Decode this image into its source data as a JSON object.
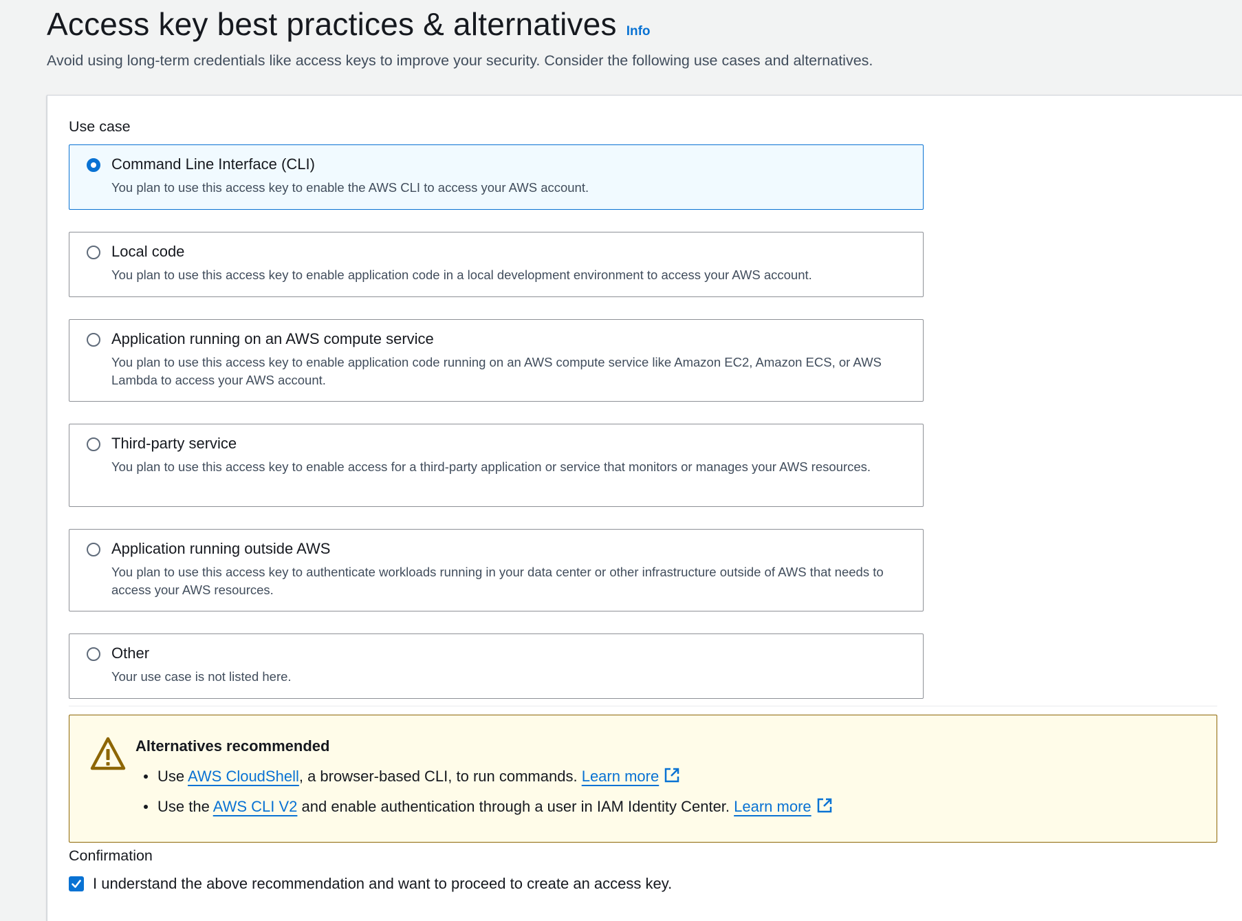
{
  "header": {
    "title": "Access key best practices & alternatives",
    "info_label": "Info",
    "description": "Avoid using long-term credentials like access keys to improve your security. Consider the following use cases and alternatives."
  },
  "use_case": {
    "label": "Use case",
    "selected": "cli",
    "options": [
      {
        "id": "cli",
        "title": "Command Line Interface (CLI)",
        "description": "You plan to use this access key to enable the AWS CLI to access your AWS account."
      },
      {
        "id": "local-code",
        "title": "Local code",
        "description": "You plan to use this access key to enable application code in a local development environment to access your AWS account."
      },
      {
        "id": "aws-compute",
        "title": "Application running on an AWS compute service",
        "description": "You plan to use this access key to enable application code running on an AWS compute service like Amazon EC2, Amazon ECS, or AWS Lambda to access your AWS account."
      },
      {
        "id": "third-party",
        "title": "Third-party service",
        "description": "You plan to use this access key to enable access for a third-party application or service that monitors or manages your AWS resources."
      },
      {
        "id": "outside-aws",
        "title": "Application running outside AWS",
        "description": "You plan to use this access key to authenticate workloads running in your data center or other infrastructure outside of AWS that needs to access your AWS resources."
      },
      {
        "id": "other",
        "title": "Other",
        "description": "Your use case is not listed here."
      }
    ]
  },
  "alert": {
    "title": "Alternatives recommended",
    "icon": "warning-icon",
    "items": [
      {
        "prefix": "Use ",
        "link_text": "AWS CloudShell",
        "suffix": ", a browser-based CLI, to run commands. ",
        "learn_more": "Learn more"
      },
      {
        "prefix": "Use the ",
        "link_text": "AWS CLI V2",
        "suffix": " and enable authentication through a user in IAM Identity Center. ",
        "learn_more": "Learn more"
      }
    ]
  },
  "confirmation": {
    "label": "Confirmation",
    "checkbox_label": "I understand the above recommendation and want to proceed to create an access key.",
    "checked": true
  },
  "colors": {
    "accent": "#0972d3",
    "warning_border": "#8d6605",
    "warning_bg": "#fffce9"
  }
}
